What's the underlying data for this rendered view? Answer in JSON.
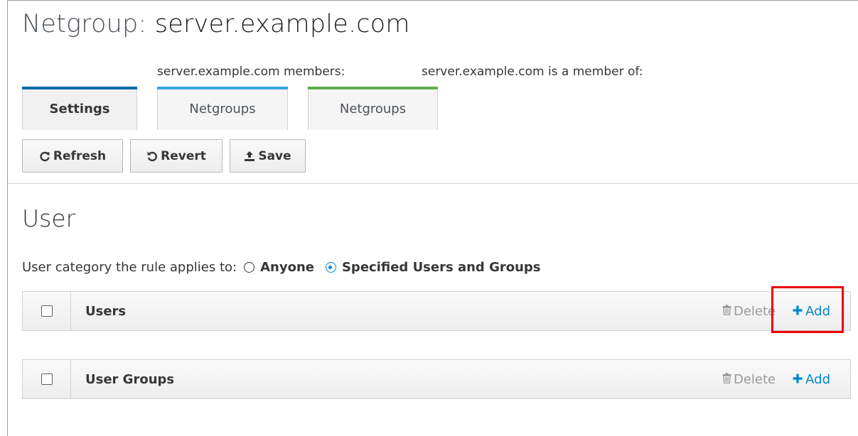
{
  "header": {
    "title_prefix": "Netgroup:",
    "title_name": "server.example.com"
  },
  "tab_groups": {
    "members_label": "server.example.com members:",
    "member_of_label": "server.example.com is a member of:"
  },
  "tabs": [
    {
      "label": "Settings",
      "active": true,
      "accent_color": "#0a6aa8"
    },
    {
      "label": "Netgroups",
      "active": false,
      "accent_color": "#39a5dc"
    },
    {
      "label": "Netgroups",
      "active": false,
      "accent_color": "#5eb04b"
    }
  ],
  "toolbar": {
    "refresh_label": "Refresh",
    "revert_label": "Revert",
    "save_label": "Save"
  },
  "section": {
    "title": "User",
    "category_label": "User category the rule applies to:",
    "options": [
      {
        "label": "Anyone",
        "selected": false
      },
      {
        "label": "Specified Users and Groups",
        "selected": true
      }
    ]
  },
  "tables": [
    {
      "title": "Users",
      "delete_label": "Delete",
      "add_label": "Add",
      "highlighted_add": true
    },
    {
      "title": "User Groups",
      "delete_label": "Delete",
      "add_label": "Add",
      "highlighted_add": false
    }
  ],
  "colors": {
    "accent_blue": "#0088ce",
    "highlight_red": "#ee0000",
    "disabled_gray": "#9a9a9a"
  }
}
